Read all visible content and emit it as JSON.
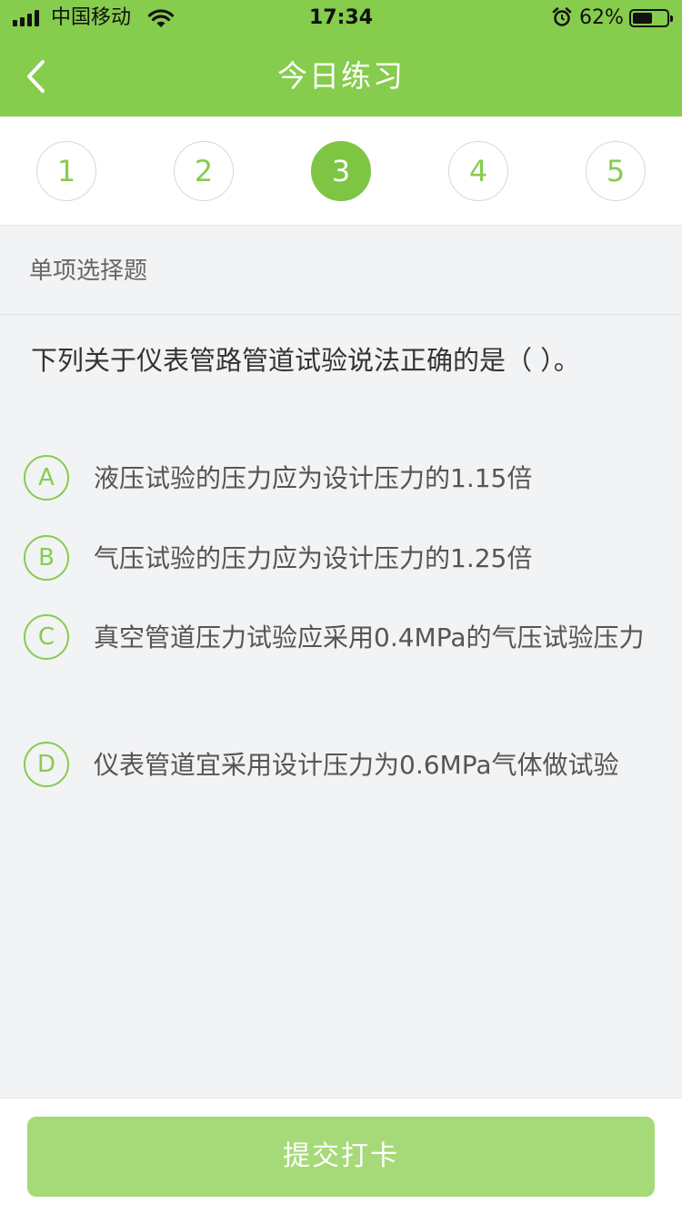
{
  "status_bar": {
    "carrier": "中国移动",
    "time": "17:34",
    "battery_percent": "62%",
    "battery_level": 0.62,
    "icons": [
      "signal-icon",
      "wifi-icon",
      "alarm-icon",
      "battery-icon"
    ]
  },
  "nav": {
    "title": "今日练习",
    "back_icon": "chevron-left-icon"
  },
  "steps": [
    {
      "label": "1",
      "active": false
    },
    {
      "label": "2",
      "active": false
    },
    {
      "label": "3",
      "active": true
    },
    {
      "label": "4",
      "active": false
    },
    {
      "label": "5",
      "active": false
    }
  ],
  "section": {
    "label": "单项选择题"
  },
  "question": {
    "text": "下列关于仪表管路管道试验说法正确的是（ ）。"
  },
  "options": [
    {
      "letter": "A",
      "text": "液压试验的压力应为设计压力的1.15倍"
    },
    {
      "letter": "B",
      "text": "气压试验的压力应为设计压力的1.25倍"
    },
    {
      "letter": "C",
      "text": "真空管道压力试验应采用0.4MPa的气压试验压力"
    },
    {
      "letter": "D",
      "text": "仪表管道宜采用设计压力为0.6MPa气体做试验"
    }
  ],
  "footer": {
    "submit_label": "提交打卡"
  },
  "colors": {
    "brand_green": "#86cc4d",
    "active_step": "#7ec544",
    "submit_disabled": "#a6da79",
    "background": "#f2f3f5"
  }
}
